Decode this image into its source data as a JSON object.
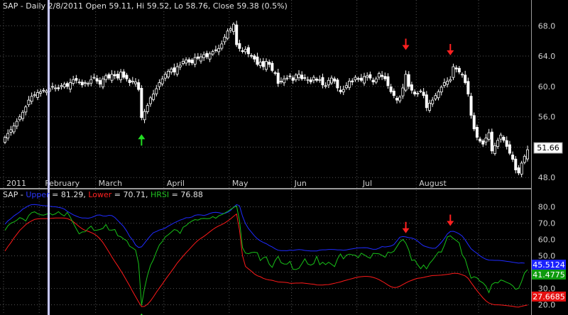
{
  "colors": {
    "background": "#000000",
    "grid": "#555555",
    "axis_text": "#cfcfcf",
    "candle": "#ffffff",
    "cursor_line": "#b8b8ff",
    "upper": "#1f2bff",
    "lower": "#ff1a1a",
    "hrsi": "#18c018",
    "arrow_down": "#ff2020",
    "arrow_up": "#22dd22",
    "last_price_box": "#ffffff"
  },
  "price_panel": {
    "header": "SAP - Daily 2/8/2011 Open 59.11, Hi 59.52, Lo 58.76, Close 59.38 (0.5%)",
    "last_price_label": "51.66"
  },
  "indicator_panel": {
    "header_prefix": "SAP - ",
    "upper_label": "Upper",
    "upper_value": " = 81.29, ",
    "lower_label": "Lower",
    "lower_value": " = 70.71, ",
    "hrsi_label": "HRSI",
    "hrsi_value": " = 76.88",
    "upper_box_label": "45.5124",
    "hrsi_box_label": "41.4775",
    "lower_box_label": "27.6685"
  },
  "chart_data": [
    {
      "type": "candlestick",
      "title": "SAP - Daily 2/8/2011 Open 59.11, Hi 59.52, Lo 58.76, Close 59.38 (0.5%)",
      "x_tick_labels": [
        "2011",
        "February",
        "March",
        "April",
        "May",
        "Jun",
        "Jul",
        "August"
      ],
      "y_ticks": [
        48.0,
        52.0,
        56.0,
        60.0,
        64.0,
        68.0
      ],
      "ylim": [
        46.9,
        69.8
      ],
      "last_price": 51.66,
      "cursor_date": "2/8/2011",
      "signals": [
        {
          "type": "down",
          "index": 135
        },
        {
          "type": "down",
          "index": 150
        },
        {
          "type": "up",
          "index": 46
        }
      ],
      "closes": [
        53.3,
        53.8,
        54.3,
        54.8,
        55.4,
        56.0,
        56.6,
        57.3,
        58.2,
        58.7,
        58.9,
        59.2,
        59.3,
        59.5,
        59.4,
        59.7,
        60.0,
        59.8,
        59.7,
        60.1,
        60.3,
        60.0,
        60.5,
        60.9,
        60.8,
        60.6,
        60.2,
        60.5,
        60.4,
        60.9,
        61.2,
        60.7,
        60.3,
        61.0,
        61.4,
        61.1,
        61.6,
        61.4,
        61.1,
        61.9,
        61.2,
        61.0,
        60.5,
        60.7,
        60.6,
        59.6,
        55.9,
        56.7,
        57.5,
        58.5,
        59.0,
        59.7,
        60.5,
        61.0,
        61.6,
        62.0,
        62.3,
        61.9,
        62.6,
        62.8,
        63.3,
        63.5,
        63.2,
        63.1,
        63.8,
        63.7,
        63.9,
        64.2,
        63.9,
        64.3,
        64.6,
        64.8,
        65.0,
        65.6,
        66.5,
        67.3,
        67.6,
        68.2,
        65.5,
        65.0,
        64.6,
        64.9,
        64.3,
        64.0,
        63.6,
        62.9,
        63.2,
        62.6,
        63.3,
        62.9,
        62.1,
        61.8,
        60.4,
        60.7,
        61.0,
        61.1,
        61.3,
        60.8,
        61.5,
        61.6,
        61.0,
        61.1,
        60.9,
        60.6,
        61.2,
        60.8,
        60.9,
        60.2,
        60.1,
        60.8,
        61.1,
        60.7,
        59.8,
        59.3,
        59.6,
        60.1,
        60.7,
        60.6,
        61.2,
        61.0,
        60.8,
        61.3,
        61.4,
        61.1,
        60.6,
        61.0,
        61.7,
        61.3,
        61.0,
        60.1,
        59.3,
        58.8,
        58.2,
        58.6,
        59.8,
        61.6,
        60.0,
        59.5,
        59.0,
        59.1,
        59.4,
        58.8,
        57.2,
        57.8,
        58.2,
        58.8,
        59.3,
        59.9,
        60.5,
        60.7,
        60.9,
        62.6,
        62.3,
        61.9,
        61.6,
        60.5,
        59.0,
        56.2,
        54.4,
        53.3,
        52.8,
        52.4,
        53.2,
        53.9,
        51.5,
        52.2,
        52.9,
        53.6,
        52.9,
        52.1,
        51.2,
        50.4,
        49.0,
        48.6,
        49.9,
        50.8,
        51.66
      ]
    },
    {
      "type": "line",
      "title": "SAP - Upper = 81.29, Lower = 70.71, HRSI = 76.88",
      "y_ticks": [
        20.0,
        30.0,
        40.0,
        50.0,
        60.0,
        70.0,
        80.0
      ],
      "ylim": [
        15.5,
        85.0
      ],
      "series": [
        {
          "name": "Upper",
          "values": [
            69.4,
            71.4,
            72.8,
            74.4,
            75.6,
            76.9,
            78.6,
            79.6,
            80.8,
            81.3,
            81.4,
            81.2,
            80.9,
            80.7,
            80.6,
            80.4,
            80.1,
            80.0,
            79.7,
            79.3,
            78.6,
            77.2,
            76.2,
            75.1,
            74.3,
            73.6,
            73.2,
            73.2,
            73.0,
            73.4,
            74.1,
            74.9,
            75.0,
            74.4,
            74.3,
            74.8,
            74.6,
            73.5,
            71.6,
            69.8,
            67.8,
            65.1,
            61.9,
            59.7,
            56.6,
            55.1,
            55.5,
            57.7,
            60.1,
            62.3,
            64.2,
            64.9,
            65.8,
            66.3,
            67.0,
            68.2,
            69.2,
            70.2,
            71.0,
            71.9,
            72.5,
            73.3,
            73.3,
            73.8,
            74.8,
            75.1,
            75.0,
            74.7,
            75.2,
            75.9,
            76.5,
            76.6,
            76.4,
            75.9,
            76.0,
            76.6,
            77.8,
            79.7,
            81.4,
            80.6,
            74.3,
            69.8,
            66.7,
            64.5,
            62.3,
            60.4,
            59.2,
            58.2,
            57.4,
            56.3,
            55.4,
            54.3,
            53.4,
            53.2,
            53.2,
            53.1,
            53.5,
            53.3,
            53.6,
            53.8,
            53.7,
            53.3,
            53.1,
            53.0,
            53.0,
            53.0,
            53.5,
            53.7,
            53.7,
            53.9,
            53.9,
            53.8,
            53.6,
            53.6,
            53.4,
            53.6,
            54.0,
            54.3,
            54.6,
            54.8,
            54.9,
            55.0,
            54.9,
            54.4,
            54.0,
            54.0,
            54.7,
            55.7,
            55.4,
            55.7,
            56.0,
            56.9,
            59.1,
            61.4,
            61.8,
            61.6,
            61.1,
            60.9,
            60.2,
            59.0,
            57.4,
            56.1,
            55.5,
            55.0,
            54.6,
            54.7,
            56.3,
            58.3,
            60.6,
            63.4,
            64.9,
            65.0,
            64.4,
            63.4,
            62.1,
            59.7,
            56.9,
            54.3,
            52.8,
            51.5,
            50.0,
            48.8,
            47.9,
            47.4,
            47.3,
            47.2,
            47.2,
            47.1,
            46.9,
            46.6,
            46.4,
            46.1,
            45.8,
            45.5,
            45.7,
            45.5124
          ]
        },
        {
          "name": "Lower",
          "values": [
            52.9,
            55.7,
            58.1,
            60.8,
            63.2,
            65.6,
            67.3,
            69.1,
            70.4,
            71.4,
            72.3,
            72.6,
            72.8,
            72.8,
            72.8,
            72.9,
            73.0,
            73.2,
            73.2,
            73.2,
            73.1,
            72.8,
            72.0,
            70.9,
            69.4,
            67.9,
            66.6,
            65.6,
            65.0,
            64.3,
            63.4,
            62.2,
            60.4,
            58.1,
            55.3,
            52.4,
            49.4,
            46.5,
            43.8,
            40.9,
            37.9,
            34.7,
            31.6,
            28.2,
            25.0,
            21.8,
            18.9,
            19.0,
            20.3,
            22.3,
            24.9,
            27.7,
            30.3,
            32.7,
            35.4,
            37.9,
            40.4,
            42.9,
            45.5,
            47.7,
            49.8,
            51.9,
            53.8,
            55.8,
            57.7,
            59.4,
            60.7,
            61.9,
            63.3,
            64.7,
            66.1,
            67.3,
            68.3,
            69.1,
            70.1,
            71.3,
            72.6,
            74.2,
            75.6,
            65.5,
            50.2,
            43.5,
            42.0,
            40.6,
            38.9,
            37.8,
            37.2,
            36.2,
            35.6,
            35.2,
            35.0,
            34.5,
            34.0,
            33.9,
            33.8,
            33.6,
            33.2,
            33.2,
            33.3,
            33.3,
            33.4,
            33.2,
            33.0,
            32.8,
            32.6,
            32.2,
            32.1,
            32.1,
            32.3,
            32.4,
            32.8,
            33.2,
            33.6,
            34.0,
            34.6,
            35.1,
            35.6,
            36.1,
            36.6,
            37.0,
            37.2,
            37.4,
            37.4,
            37.2,
            36.8,
            36.2,
            35.4,
            34.4,
            33.3,
            32.1,
            31.1,
            30.6,
            30.7,
            31.4,
            32.4,
            33.4,
            34.3,
            35.0,
            35.7,
            36.2,
            36.5,
            36.8,
            37.2,
            37.6,
            37.9,
            38.0,
            38.1,
            38.2,
            38.4,
            38.6,
            38.9,
            39.3,
            39.3,
            39.0,
            38.4,
            37.7,
            36.2,
            33.6,
            31.1,
            28.6,
            26.4,
            24.2,
            22.4,
            21.1,
            20.4,
            20.0,
            20.0,
            19.9,
            19.7,
            19.5,
            19.3,
            19.1,
            18.7,
            18.6,
            19.1,
            19.5,
            19.9
          ]
        },
        {
          "name": "HRSI",
          "values": [
            65.6,
            68.4,
            70.0,
            70.7,
            71.8,
            73.4,
            72.6,
            71.3,
            74.7,
            76.4,
            76.9,
            75.8,
            75.1,
            74.9,
            75.5,
            76.2,
            75.0,
            75.7,
            77.0,
            75.4,
            74.4,
            76.6,
            73.6,
            70.0,
            66.6,
            63.4,
            64.6,
            64.7,
            66.7,
            68.2,
            65.5,
            65.7,
            66.1,
            66.8,
            69.2,
            65.8,
            65.7,
            66.1,
            62.3,
            61.7,
            60.3,
            59.3,
            55.9,
            54.8,
            53.5,
            45.2,
            19.7,
            30.0,
            38.0,
            44.1,
            47.7,
            52.5,
            56.7,
            58.7,
            61.6,
            62.9,
            64.5,
            66.1,
            65.6,
            63.7,
            67.5,
            68.5,
            70.2,
            71.3,
            72.2,
            71.9,
            72.7,
            72.9,
            72.7,
            72.9,
            74.0,
            73.0,
            74.5,
            75.2,
            76.2,
            77.2,
            78.4,
            79.6,
            80.6,
            71.3,
            55.1,
            51.7,
            51.3,
            52.0,
            52.2,
            51.9,
            47.1,
            48.8,
            49.4,
            44.9,
            42.9,
            47.1,
            49.6,
            45.8,
            45.0,
            44.9,
            46.6,
            41.8,
            41.6,
            42.4,
            45.2,
            48.2,
            45.0,
            44.3,
            45.2,
            49.7,
            44.6,
            46.1,
            44.6,
            46.1,
            44.8,
            43.4,
            48.1,
            51.1,
            48.1,
            50.4,
            51.0,
            50.6,
            50.3,
            48.8,
            51.6,
            50.6,
            49.4,
            48.5,
            51.5,
            51.4,
            51.2,
            50.3,
            49.1,
            52.3,
            51.8,
            52.8,
            55.6,
            58.5,
            60.0,
            57.8,
            53.6,
            47.2,
            47.5,
            44.5,
            42.1,
            44.4,
            42.0,
            45.3,
            47.4,
            49.8,
            52.4,
            52.3,
            56.5,
            61.6,
            62.3,
            60.6,
            59.4,
            57.9,
            50.7,
            48.0,
            41.8,
            36.3,
            37.2,
            36.5,
            34.5,
            33.4,
            31.4,
            27.5,
            32.5,
            33.6,
            33.4,
            35.2,
            34.6,
            33.7,
            33.0,
            31.7,
            29.5,
            30.1,
            34.2,
            39.5,
            41.4775
          ]
        }
      ],
      "signals": [
        {
          "type": "down",
          "index": 135
        },
        {
          "type": "down",
          "index": 150
        },
        {
          "type": "up",
          "index": 46
        }
      ]
    }
  ]
}
